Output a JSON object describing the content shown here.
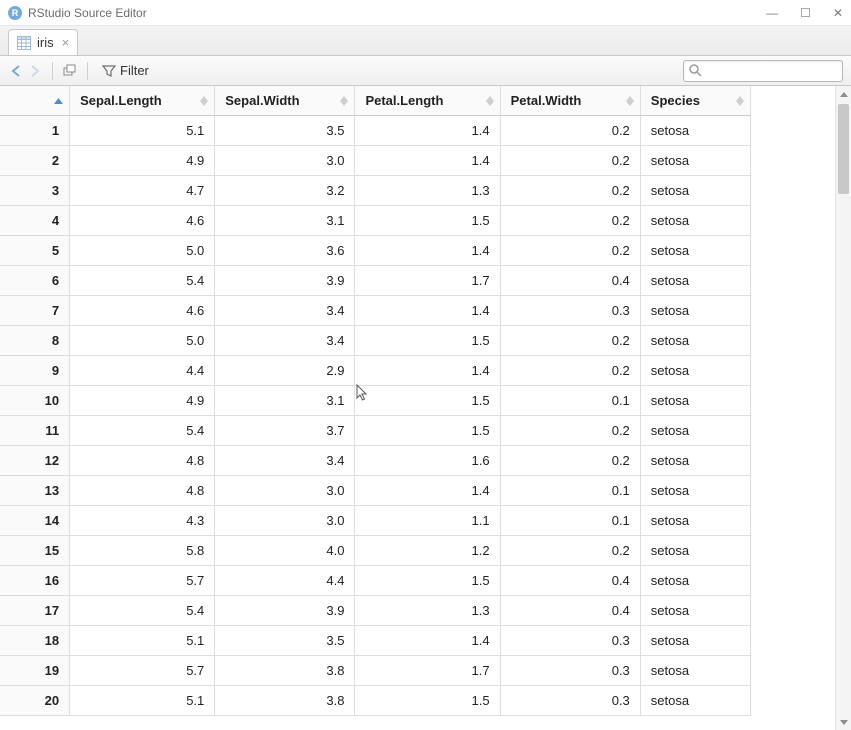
{
  "window": {
    "title": "RStudio Source Editor"
  },
  "tab": {
    "label": "iris"
  },
  "toolbar": {
    "filter_label": "Filter",
    "search_placeholder": ""
  },
  "table": {
    "columns": [
      "Sepal.Length",
      "Sepal.Width",
      "Petal.Length",
      "Petal.Width",
      "Species"
    ],
    "rows": [
      {
        "n": "1",
        "sl": "5.1",
        "sw": "3.5",
        "pl": "1.4",
        "pw": "0.2",
        "sp": "setosa"
      },
      {
        "n": "2",
        "sl": "4.9",
        "sw": "3.0",
        "pl": "1.4",
        "pw": "0.2",
        "sp": "setosa"
      },
      {
        "n": "3",
        "sl": "4.7",
        "sw": "3.2",
        "pl": "1.3",
        "pw": "0.2",
        "sp": "setosa"
      },
      {
        "n": "4",
        "sl": "4.6",
        "sw": "3.1",
        "pl": "1.5",
        "pw": "0.2",
        "sp": "setosa"
      },
      {
        "n": "5",
        "sl": "5.0",
        "sw": "3.6",
        "pl": "1.4",
        "pw": "0.2",
        "sp": "setosa"
      },
      {
        "n": "6",
        "sl": "5.4",
        "sw": "3.9",
        "pl": "1.7",
        "pw": "0.4",
        "sp": "setosa"
      },
      {
        "n": "7",
        "sl": "4.6",
        "sw": "3.4",
        "pl": "1.4",
        "pw": "0.3",
        "sp": "setosa"
      },
      {
        "n": "8",
        "sl": "5.0",
        "sw": "3.4",
        "pl": "1.5",
        "pw": "0.2",
        "sp": "setosa"
      },
      {
        "n": "9",
        "sl": "4.4",
        "sw": "2.9",
        "pl": "1.4",
        "pw": "0.2",
        "sp": "setosa"
      },
      {
        "n": "10",
        "sl": "4.9",
        "sw": "3.1",
        "pl": "1.5",
        "pw": "0.1",
        "sp": "setosa"
      },
      {
        "n": "11",
        "sl": "5.4",
        "sw": "3.7",
        "pl": "1.5",
        "pw": "0.2",
        "sp": "setosa"
      },
      {
        "n": "12",
        "sl": "4.8",
        "sw": "3.4",
        "pl": "1.6",
        "pw": "0.2",
        "sp": "setosa"
      },
      {
        "n": "13",
        "sl": "4.8",
        "sw": "3.0",
        "pl": "1.4",
        "pw": "0.1",
        "sp": "setosa"
      },
      {
        "n": "14",
        "sl": "4.3",
        "sw": "3.0",
        "pl": "1.1",
        "pw": "0.1",
        "sp": "setosa"
      },
      {
        "n": "15",
        "sl": "5.8",
        "sw": "4.0",
        "pl": "1.2",
        "pw": "0.2",
        "sp": "setosa"
      },
      {
        "n": "16",
        "sl": "5.7",
        "sw": "4.4",
        "pl": "1.5",
        "pw": "0.4",
        "sp": "setosa"
      },
      {
        "n": "17",
        "sl": "5.4",
        "sw": "3.9",
        "pl": "1.3",
        "pw": "0.4",
        "sp": "setosa"
      },
      {
        "n": "18",
        "sl": "5.1",
        "sw": "3.5",
        "pl": "1.4",
        "pw": "0.3",
        "sp": "setosa"
      },
      {
        "n": "19",
        "sl": "5.7",
        "sw": "3.8",
        "pl": "1.7",
        "pw": "0.3",
        "sp": "setosa"
      },
      {
        "n": "20",
        "sl": "5.1",
        "sw": "3.8",
        "pl": "1.5",
        "pw": "0.3",
        "sp": "setosa"
      }
    ]
  }
}
